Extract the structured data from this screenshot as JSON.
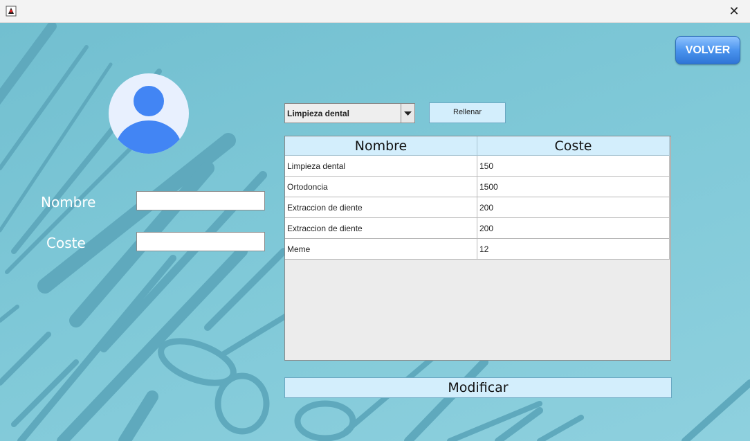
{
  "titlebar": {
    "title": "",
    "close_glyph": "✕",
    "app_icon": "java-duke-icon"
  },
  "header": {
    "back_label": "VOLVER"
  },
  "avatar": {
    "icon": "user-avatar-icon"
  },
  "form": {
    "nombre_label": "Nombre",
    "nombre_value": "",
    "coste_label": "Coste",
    "coste_value": ""
  },
  "selector": {
    "selected": "Limpieza dental",
    "fill_label": "Rellenar"
  },
  "table": {
    "columns": [
      "Nombre",
      "Coste"
    ],
    "rows": [
      [
        "Limpieza dental",
        "150"
      ],
      [
        "Ortodoncia",
        "1500"
      ],
      [
        "Extraccion de diente",
        "200"
      ],
      [
        "Extraccion de diente",
        "200"
      ],
      [
        "Meme",
        "12"
      ]
    ]
  },
  "actions": {
    "modify_label": "Modificar"
  },
  "colors": {
    "background": "#7cc6d6",
    "button_light": "#d3eefc",
    "volver_blue": "#4b94ee",
    "avatar_blue": "#4285f4",
    "avatar_bg": "#e8f0fe"
  }
}
